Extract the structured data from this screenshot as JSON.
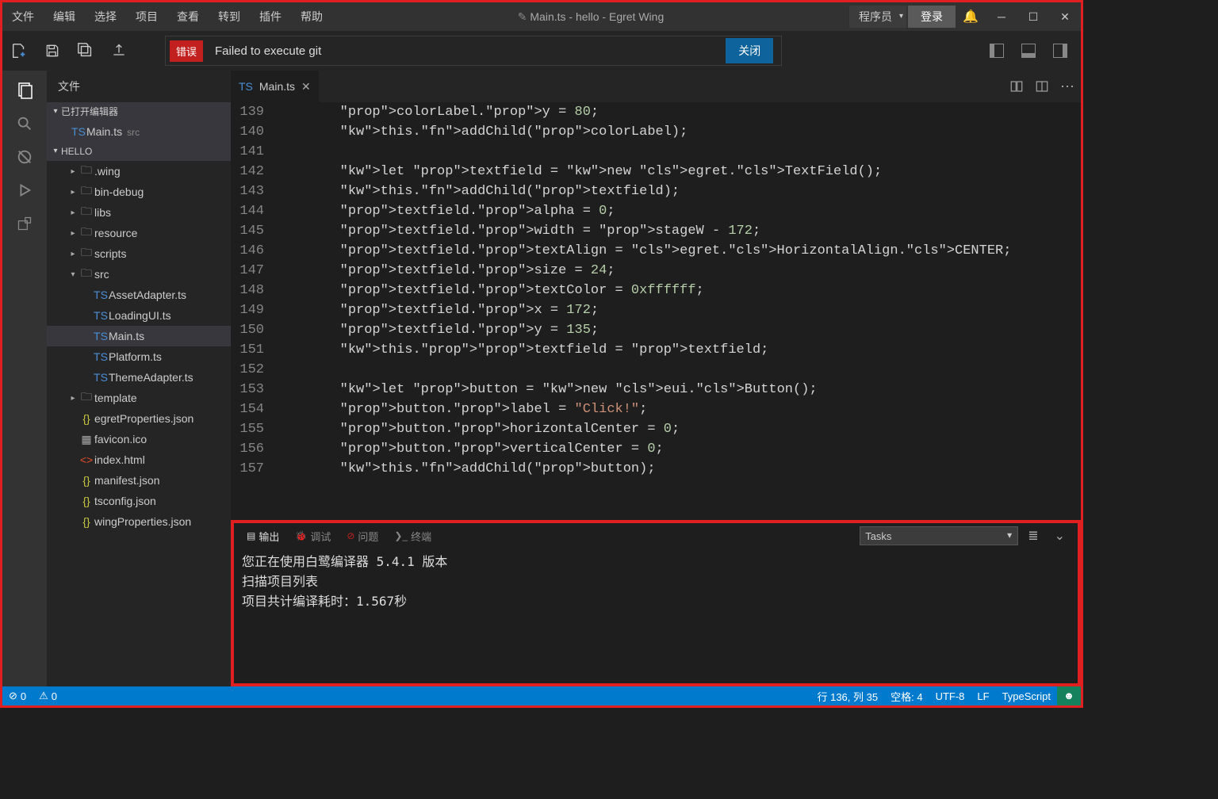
{
  "menu": [
    "文件",
    "编辑",
    "选择",
    "项目",
    "查看",
    "转到",
    "插件",
    "帮助"
  ],
  "title": "Main.ts - hello - Egret Wing",
  "userRole": "程序员",
  "login": "登录",
  "notification": {
    "badge": "错误",
    "message": "Failed to execute git",
    "close": "关闭"
  },
  "sidebar": {
    "header": "文件",
    "openEditors": {
      "title": "已打开编辑器",
      "item": {
        "file": "Main.ts",
        "dir": "src"
      }
    },
    "project": "HELLO",
    "tree": [
      {
        "indent": 1,
        "tw": "▸",
        "ic": "folder",
        "label": ".wing"
      },
      {
        "indent": 1,
        "tw": "▸",
        "ic": "folder",
        "label": "bin-debug"
      },
      {
        "indent": 1,
        "tw": "▸",
        "ic": "folder",
        "label": "libs"
      },
      {
        "indent": 1,
        "tw": "▸",
        "ic": "folder",
        "label": "resource"
      },
      {
        "indent": 1,
        "tw": "▸",
        "ic": "folder",
        "label": "scripts"
      },
      {
        "indent": 1,
        "tw": "▾",
        "ic": "folder",
        "label": "src"
      },
      {
        "indent": 2,
        "tw": "",
        "ic": "ts",
        "label": "AssetAdapter.ts"
      },
      {
        "indent": 2,
        "tw": "",
        "ic": "ts",
        "label": "LoadingUI.ts"
      },
      {
        "indent": 2,
        "tw": "",
        "ic": "ts",
        "label": "Main.ts",
        "selected": true
      },
      {
        "indent": 2,
        "tw": "",
        "ic": "ts",
        "label": "Platform.ts"
      },
      {
        "indent": 2,
        "tw": "",
        "ic": "ts",
        "label": "ThemeAdapter.ts"
      },
      {
        "indent": 1,
        "tw": "▸",
        "ic": "folder",
        "label": "template"
      },
      {
        "indent": 1,
        "tw": "",
        "ic": "json",
        "label": "egretProperties.json"
      },
      {
        "indent": 1,
        "tw": "",
        "ic": "file",
        "label": "favicon.ico"
      },
      {
        "indent": 1,
        "tw": "",
        "ic": "html",
        "label": "index.html"
      },
      {
        "indent": 1,
        "tw": "",
        "ic": "json",
        "label": "manifest.json"
      },
      {
        "indent": 1,
        "tw": "",
        "ic": "json",
        "label": "tsconfig.json"
      },
      {
        "indent": 1,
        "tw": "",
        "ic": "json",
        "label": "wingProperties.json"
      }
    ]
  },
  "editor": {
    "tab": {
      "name": "Main.ts"
    },
    "startLine": 139,
    "lines": [
      "        colorLabel.y = 80;",
      "        this.addChild(colorLabel);",
      "",
      "        let textfield = new egret.TextField();",
      "        this.addChild(textfield);",
      "        textfield.alpha = 0;",
      "        textfield.width = stageW - 172;",
      "        textfield.textAlign = egret.HorizontalAlign.CENTER;",
      "        textfield.size = 24;",
      "        textfield.textColor = 0xffffff;",
      "        textfield.x = 172;",
      "        textfield.y = 135;",
      "        this.textfield = textfield;",
      "",
      "        let button = new eui.Button();",
      "        button.label = \"Click!\";",
      "        button.horizontalCenter = 0;",
      "        button.verticalCenter = 0;",
      "        this.addChild(button);"
    ]
  },
  "panel": {
    "tabs": {
      "output": "输出",
      "debug": "调试",
      "problems": "问题",
      "terminal": "终端"
    },
    "select": "Tasks",
    "lines": [
      "您正在使用白鹭编译器 5.4.1 版本",
      "扫描项目列表",
      "项目共计编译耗时：1.567秒"
    ]
  },
  "status": {
    "errors": "0",
    "warnings": "0",
    "cursor": "行 136, 列 35",
    "spaces": "空格: 4",
    "encoding": "UTF-8",
    "eol": "LF",
    "lang": "TypeScript"
  }
}
